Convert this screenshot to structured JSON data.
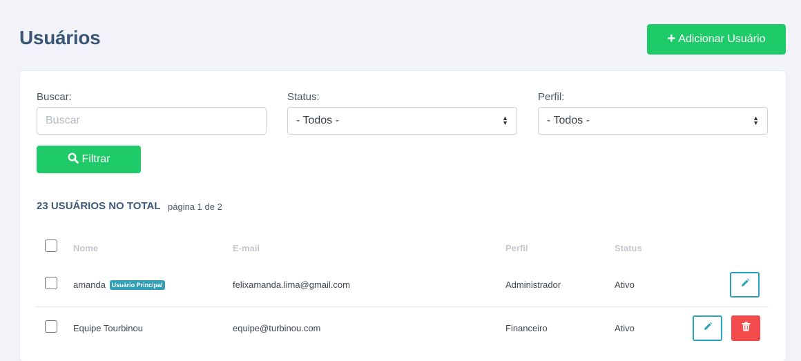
{
  "header": {
    "title": "Usuários",
    "add_button_label": "Adicionar Usuário"
  },
  "filters": {
    "search_label": "Buscar:",
    "search_placeholder": "Buscar",
    "search_value": "",
    "status_label": "Status:",
    "status_selected": "- Todos -",
    "profile_label": "Perfil:",
    "profile_selected": "- Todos -",
    "filter_button_label": "Filtrar"
  },
  "summary": {
    "total_text": "23 usuários no total",
    "page_prefix": "página",
    "current_page": "1",
    "page_sep": "de",
    "total_pages": "2"
  },
  "table": {
    "columns": [
      "Nome",
      "E-mail",
      "Perfil",
      "Status"
    ],
    "rows": [
      {
        "name": "amanda",
        "badge": "Usuário Principal",
        "email": "felixamanda.lima@gmail.com",
        "profile": "Administrador",
        "status": "Ativo",
        "actions": [
          "edit"
        ]
      },
      {
        "name": "Equipe Tourbinou",
        "badge": "",
        "email": "equipe@turbinou.com",
        "profile": "Financeiro",
        "status": "Ativo",
        "actions": [
          "edit",
          "delete"
        ]
      }
    ]
  },
  "icons": {
    "add": "plus-icon",
    "filter": "search-icon",
    "edit": "pencil-icon",
    "delete": "trash-icon"
  },
  "colors": {
    "accent_green": "#1fcb68",
    "title_blue": "#3b5677",
    "edit_border": "#2aa1bd",
    "delete_red": "#f34b4b",
    "badge_teal": "#2f9fb8"
  }
}
